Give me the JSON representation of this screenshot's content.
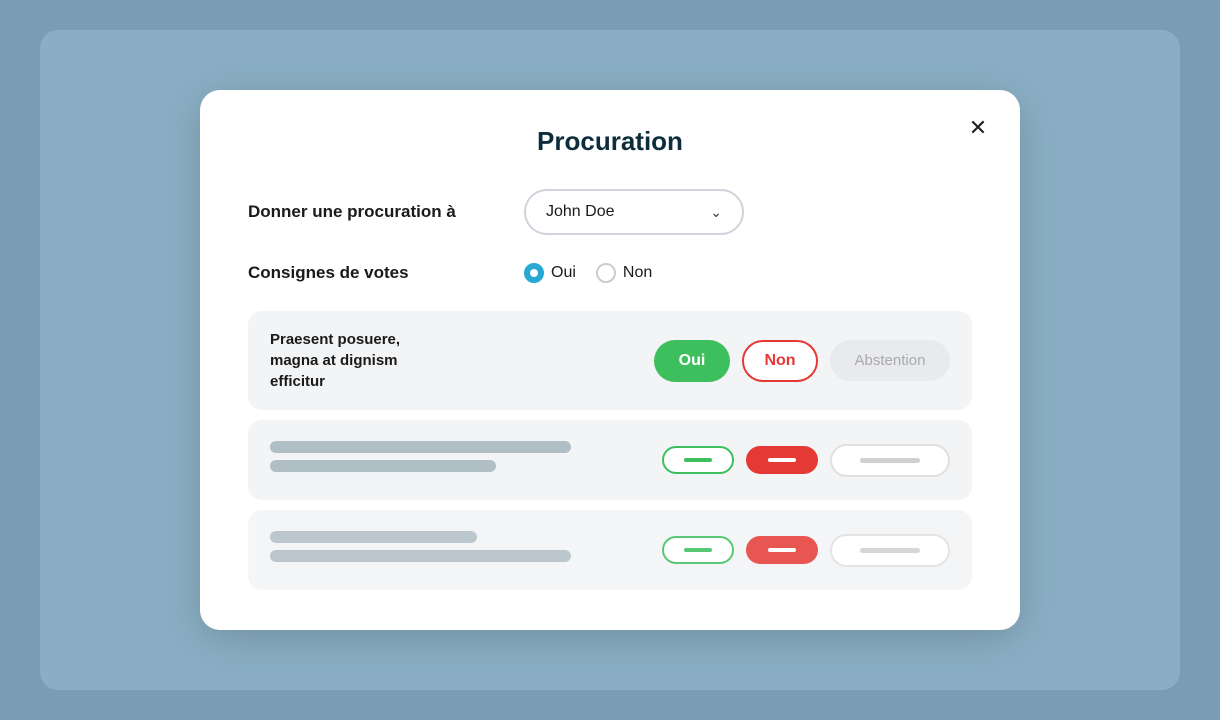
{
  "modal": {
    "title": "Procuration",
    "close_label": "×"
  },
  "procuration_field": {
    "label": "Donner une procuration à",
    "selected_person": "John Doe"
  },
  "consignes_field": {
    "label": "Consignes de votes",
    "option_oui": "Oui",
    "option_non": "Non",
    "selected": "oui"
  },
  "vote_items": [
    {
      "id": 1,
      "text": "Praesent posuere, magna at dignism efficitur",
      "selected": "non"
    },
    {
      "id": 2,
      "text": "",
      "selected": "non"
    },
    {
      "id": 3,
      "text": "",
      "selected": "non"
    }
  ],
  "buttons": {
    "oui_label": "Oui",
    "non_label": "Non",
    "abstention_label": "Abstention"
  }
}
